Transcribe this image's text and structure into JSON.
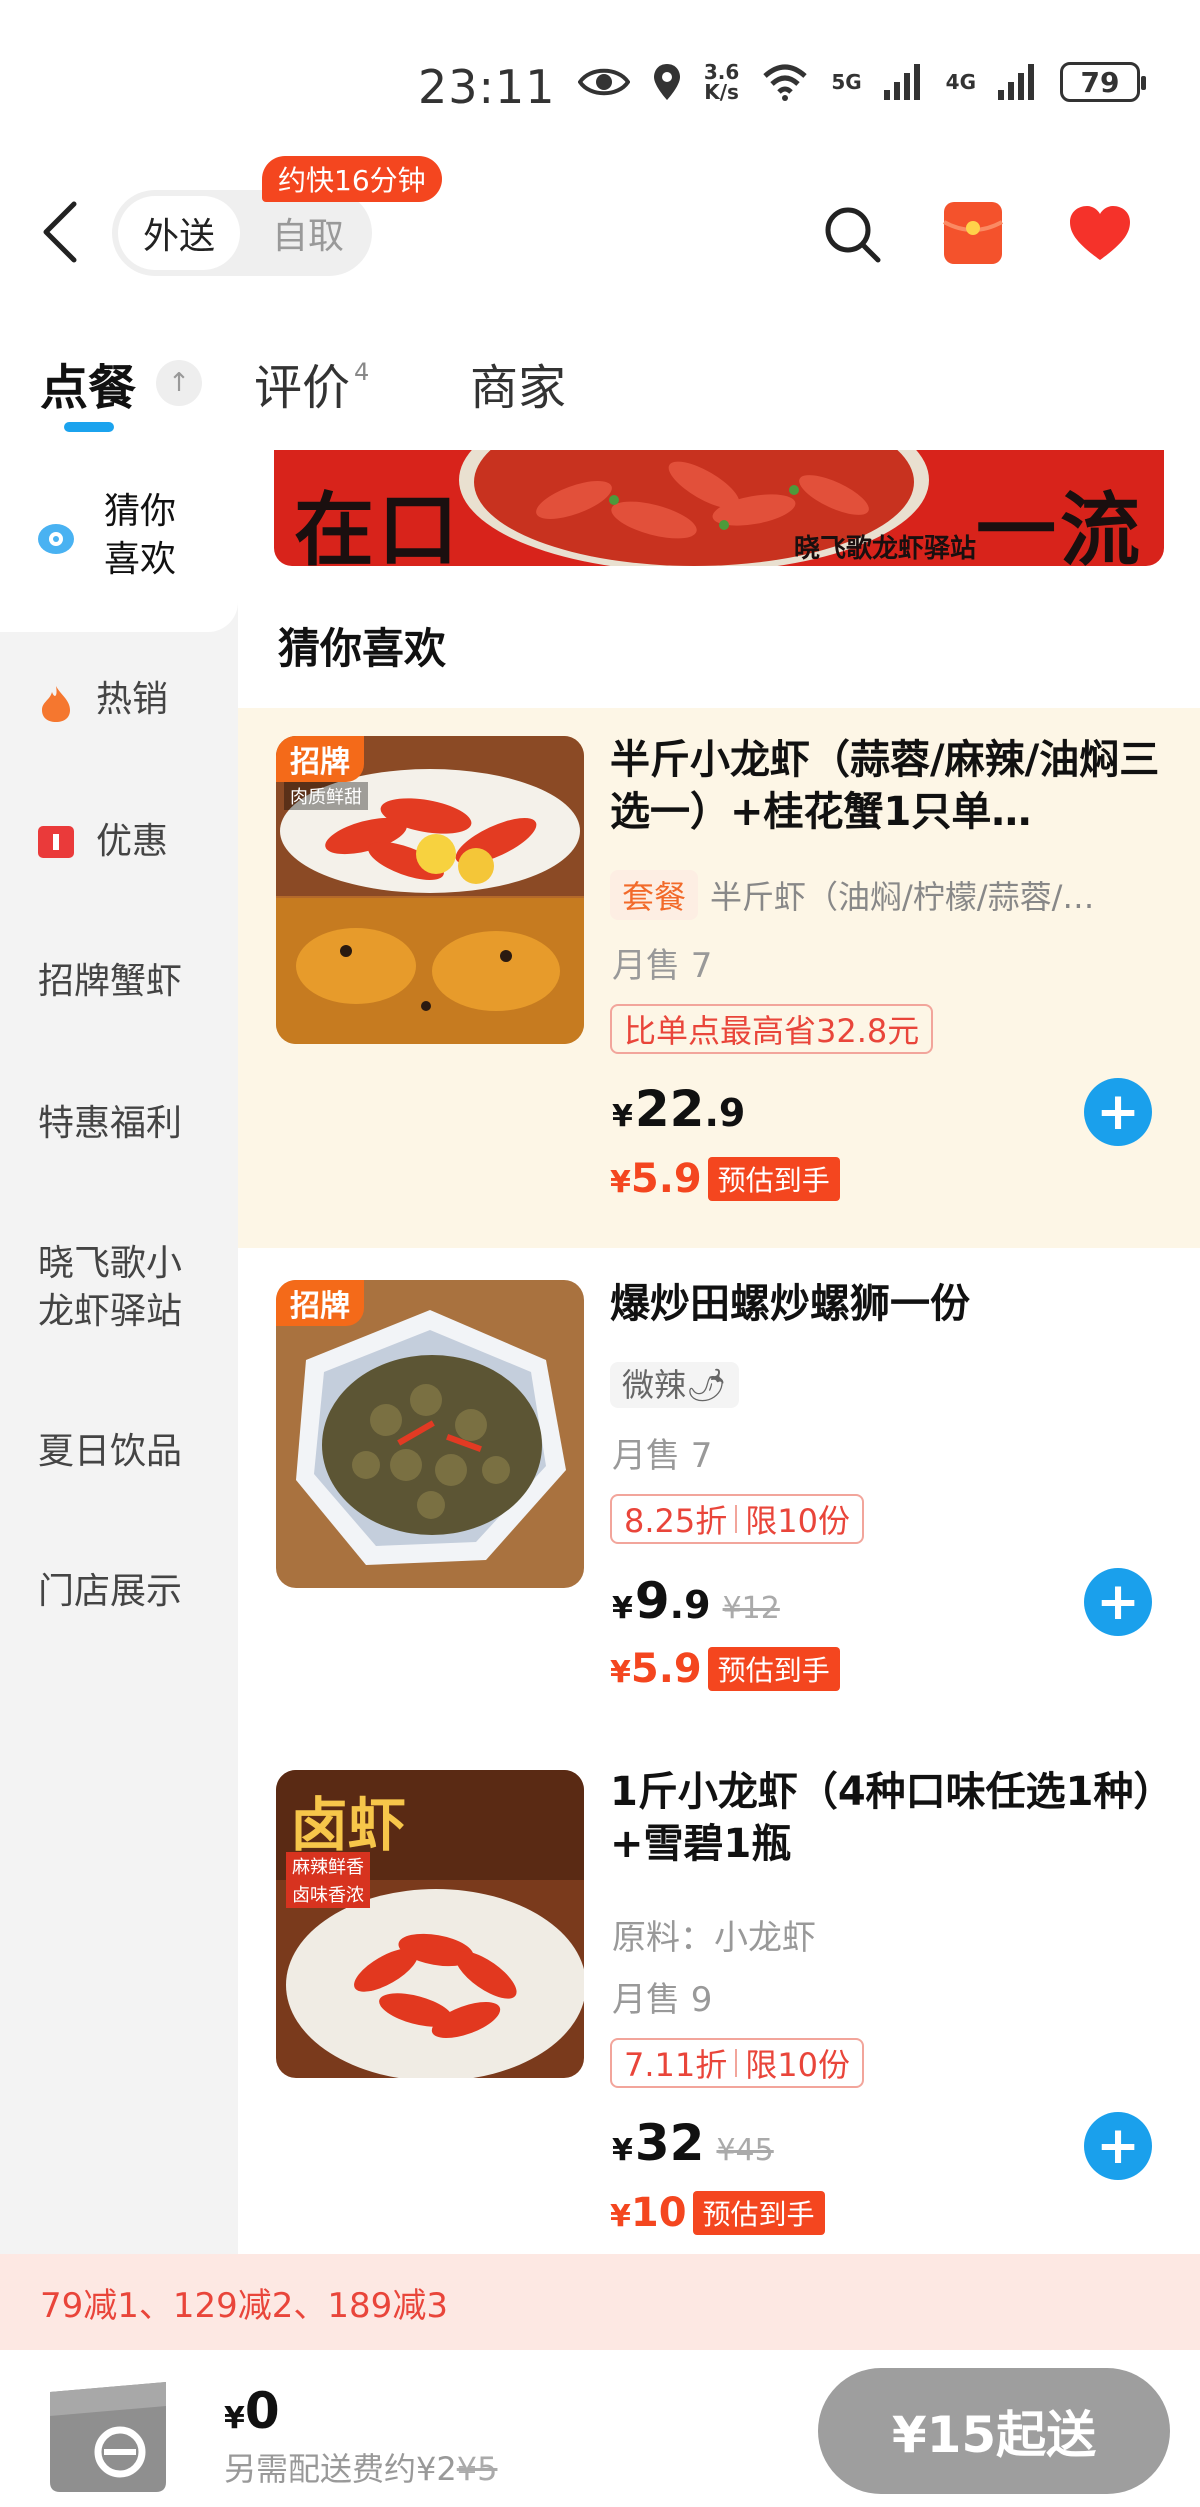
{
  "status_bar": {
    "time": "23:11",
    "speed_top": "3.6",
    "speed_bottom": "K/s",
    "net1": "5G",
    "net2": "4G",
    "battery": "79"
  },
  "header": {
    "mode_delivery": "外送",
    "mode_pickup": "自取",
    "eta_badge": "约快16分钟"
  },
  "tabs": {
    "order": "点餐",
    "top_icon": "↑",
    "review": "评价",
    "review_count": "4",
    "shop": "商家"
  },
  "sidebar": {
    "items": [
      {
        "label": "猜你\n喜欢"
      },
      {
        "label": "热销"
      },
      {
        "label": "优惠"
      },
      {
        "label": "招牌蟹虾"
      },
      {
        "label": "特惠福利"
      },
      {
        "label": "晓飞歌小\n龙虾驿站"
      },
      {
        "label": "夏日饮品"
      },
      {
        "label": "门店展示"
      }
    ]
  },
  "banner": {
    "text_left": "在口",
    "text_right": "一流",
    "text_bottom": "晓飞歌龙虾驿站"
  },
  "section": {
    "title": "猜你喜欢"
  },
  "products": [
    {
      "tag": "招牌",
      "img_caption": "肉质鲜甜",
      "name": "半斤小龙虾（蒜蓉/麻辣/油焖三选一）+桂花蟹1只单…",
      "set_tag": "套餐",
      "set_desc": "半斤虾（油焖/柠檬/蒜蓉/…",
      "sold": "月售 7",
      "promo": "比单点最高省32.8元",
      "price_yen": "¥",
      "price_int": "22",
      "price_dec": ".9",
      "est_yen": "¥",
      "est_price": "5.9",
      "est_label": "预估到手"
    },
    {
      "tag": "招牌",
      "name": "爆炒田螺炒螺狮一份",
      "spicy": "微辣🌶",
      "sold": "月售 7",
      "promo_discount": "8.25折",
      "promo_limit": "限10份",
      "price_yen": "¥",
      "price_int": "9",
      "price_dec": ".9",
      "price_orig": "¥12",
      "est_yen": "¥",
      "est_price": "5.9",
      "est_label": "预估到手"
    },
    {
      "img_title": "卤虾",
      "img_sub1": "麻辣鲜香",
      "img_sub2": "卤味香浓",
      "name": "1斤小龙虾（4种口味任选1种）+雪碧1瓶",
      "ingredients": "原料：小龙虾",
      "sold": "月售 9",
      "promo_discount": "7.11折",
      "promo_limit": "限10份",
      "price_yen": "¥",
      "price_int": "32",
      "price_orig": "¥45",
      "est_yen": "¥",
      "est_price": "10",
      "est_label": "预估到手"
    }
  ],
  "add_symbol": "+",
  "footer": {
    "discount": "79减1、129减2、189减3",
    "total_yen": "¥",
    "total": "0",
    "delivery_prefix": "另需配送费约¥2",
    "delivery_orig": "¥5",
    "min_order": "¥15起送"
  },
  "colors": {
    "accent_blue": "#1aa0ec",
    "accent_red": "#f4461f",
    "tag_orange": "#f46a19"
  }
}
